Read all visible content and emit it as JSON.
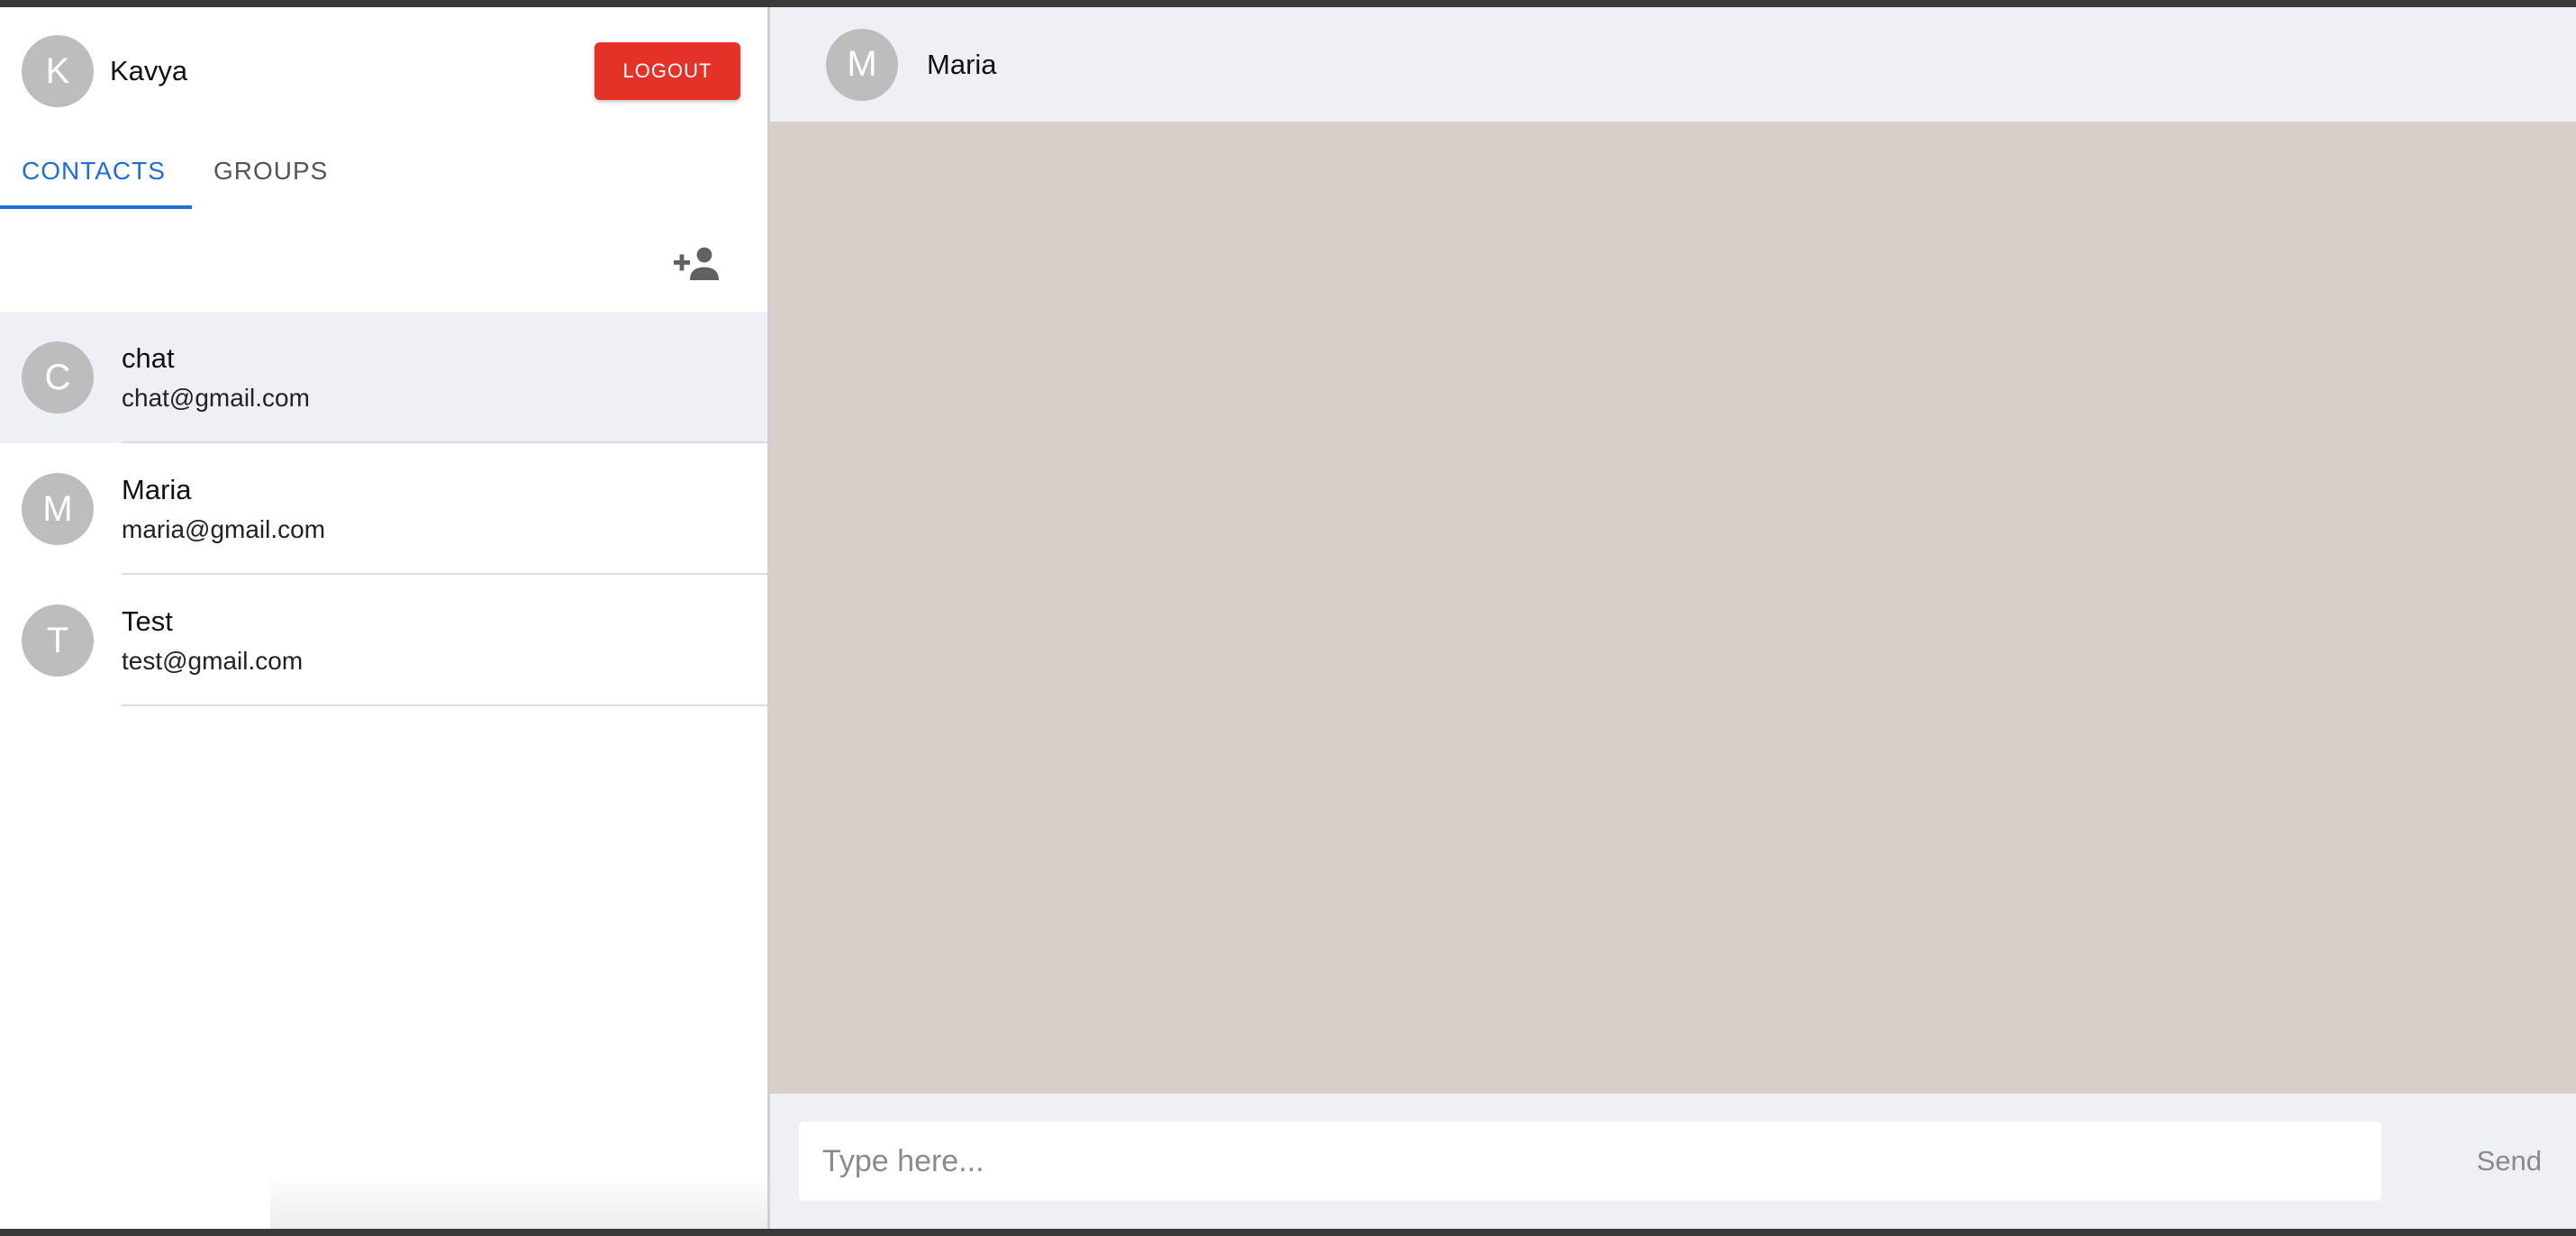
{
  "user": {
    "avatar_letter": "K",
    "name": "Kavya"
  },
  "header": {
    "logout_label": "LOGOUT"
  },
  "tabs": [
    {
      "label": "CONTACTS",
      "active": true
    },
    {
      "label": "GROUPS",
      "active": false
    }
  ],
  "toolbar": {
    "add_contact_icon": "person-add-icon"
  },
  "contacts": [
    {
      "avatar_letter": "C",
      "name": "chat",
      "email": "chat@gmail.com",
      "selected": true
    },
    {
      "avatar_letter": "M",
      "name": "Maria",
      "email": "maria@gmail.com",
      "selected": false
    },
    {
      "avatar_letter": "T",
      "name": "Test",
      "email": "test@gmail.com",
      "selected": false
    }
  ],
  "chat": {
    "peer_avatar_letter": "M",
    "peer_name": "Maria",
    "input_placeholder": "Type here...",
    "input_value": "",
    "send_label": "Send"
  },
  "colors": {
    "accent": "#1f6ed4",
    "logout": "#e53228",
    "chat_background": "#d8cfca",
    "header_background": "#eff0f5",
    "avatar": "#bdbdbd"
  }
}
